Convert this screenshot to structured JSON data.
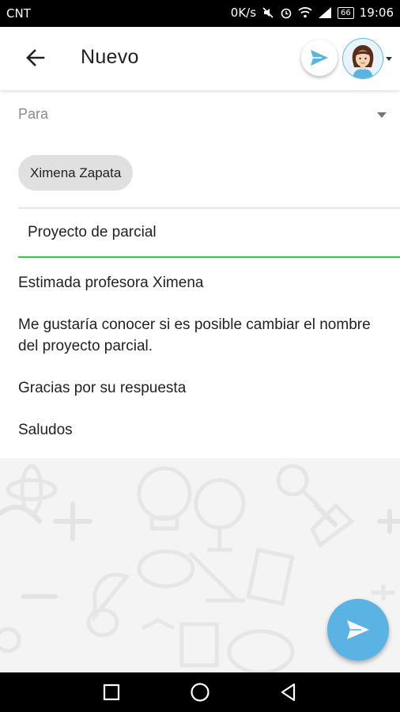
{
  "status_bar": {
    "carrier": "CNT",
    "speed": "0K/s",
    "battery": "66",
    "time": "19:06"
  },
  "app_bar": {
    "title": "Nuevo",
    "back_icon": "arrow-back-icon",
    "send_icon": "send-icon",
    "avatar_icon": "user-avatar-icon"
  },
  "compose": {
    "to_label": "Para",
    "recipients": [
      "Ximena Zapata"
    ],
    "subject": "Proyecto de parcial",
    "body": [
      "Estimada profesora Ximena",
      "Me gustaría conocer si es posible cambiar el nombre del proyecto parcial.",
      "Gracias por su respuesta",
      "Saludos"
    ]
  },
  "colors": {
    "accent_blue": "#5ab3e3",
    "subject_underline": "#2ecc40",
    "chip_bg": "#e0e0e0"
  },
  "nav_bar": {
    "recents_icon": "square-recents-icon",
    "home_icon": "circle-home-icon",
    "back_icon": "triangle-back-icon"
  }
}
